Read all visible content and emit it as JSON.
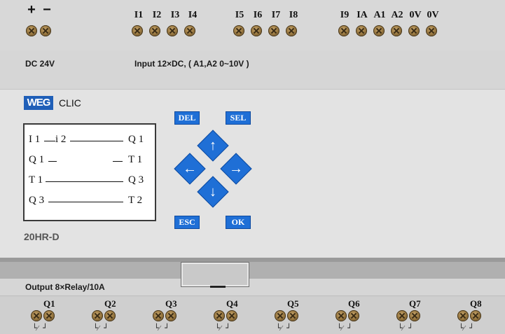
{
  "top_terminals": {
    "power": [
      "+",
      "−"
    ],
    "inputs": [
      "I1",
      "I2",
      "I3",
      "I4",
      "I5",
      "I6",
      "I7",
      "I8",
      "I9",
      "IA",
      "A1",
      "A2",
      "0V",
      "0V"
    ]
  },
  "info": {
    "supply": "DC 24V",
    "input_spec": "Input 12×DC, ( A1,A2  0~10V )"
  },
  "brand": {
    "logo": "WEG",
    "product": "CLIC"
  },
  "lcd": {
    "r1a": "I 1",
    "r1b": "i 2",
    "r1c": "Q 1",
    "r2a": "Q 1",
    "r2c": "T 1",
    "r3a": "T 1",
    "r3c": "Q 3",
    "r4a": "Q 3",
    "r4c": "T 2"
  },
  "keys": {
    "del": "DEL",
    "sel": "SEL",
    "esc": "ESC",
    "ok": "OK",
    "up": "↑",
    "down": "↓",
    "left": "←",
    "right": "→"
  },
  "model": "20HR-D",
  "output_spec": "Output 8×Relay/10A",
  "outputs": [
    "Q1",
    "Q2",
    "Q3",
    "Q4",
    "Q5",
    "Q6",
    "Q7",
    "Q8"
  ],
  "contact_symbol": "└⁄ ┘",
  "colors": {
    "key_blue": "#1f6fd6",
    "logo_blue": "#1f5fb8",
    "screw_brass": "#9b7a42"
  }
}
